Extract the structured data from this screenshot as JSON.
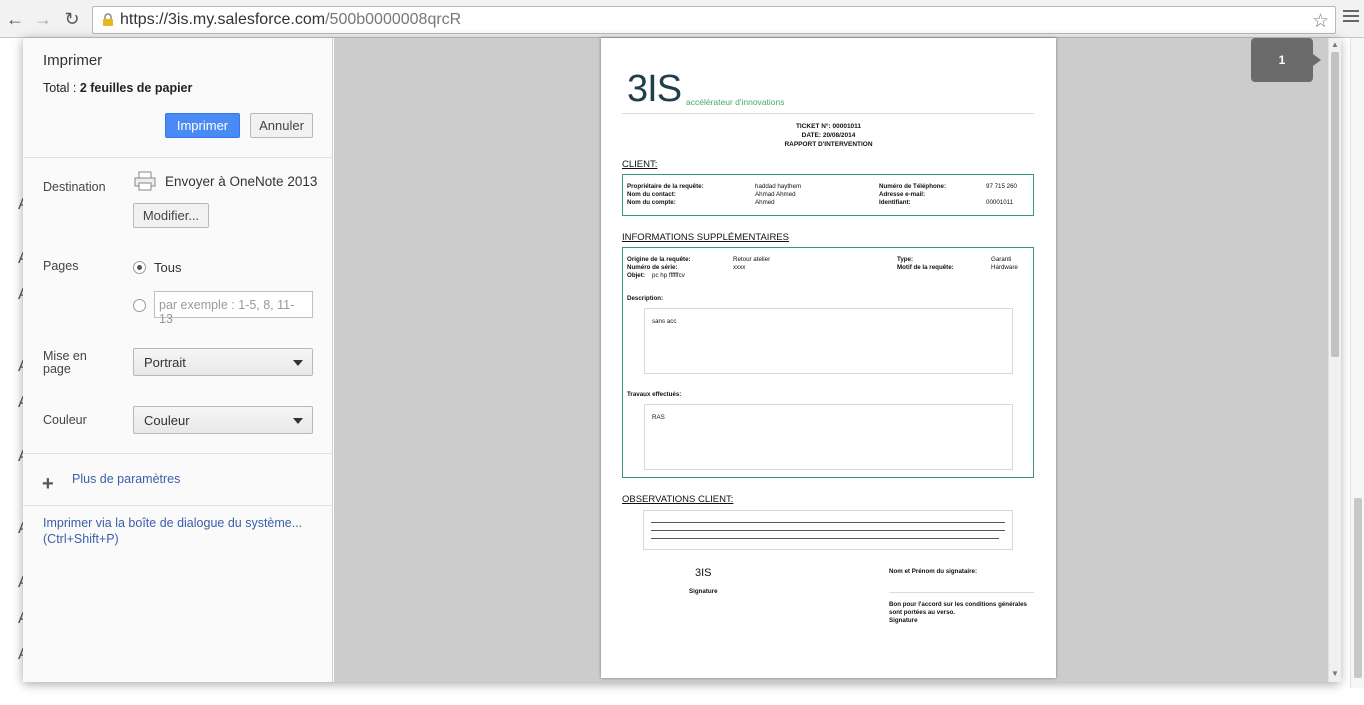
{
  "browser": {
    "url_host": "https://3is.my.salesforce.com",
    "url_path": "/500b0000008qrcR"
  },
  "background_letters": [
    "A",
    "A",
    "A",
    "A",
    "A",
    "A",
    "A",
    "A",
    "A",
    "A",
    "A"
  ],
  "print_dialog": {
    "title": "Imprimer",
    "total_label": "Total : ",
    "total_value": "2 feuilles de papier",
    "print_button": "Imprimer",
    "cancel_button": "Annuler",
    "destination_label": "Destination",
    "destination_value": "Envoyer à OneNote 2013",
    "modify_button": "Modifier...",
    "pages_label": "Pages",
    "pages_all": "Tous",
    "pages_placeholder": "par exemple : 1-5, 8, 11-13",
    "layout_label": "Mise en page",
    "layout_value": "Portrait",
    "color_label": "Couleur",
    "color_value": "Couleur",
    "more_settings": "Plus de paramètres",
    "system_dialog_line1": "Imprimer via la boîte de dialogue du système...",
    "system_dialog_line2": "(Ctrl+Shift+P)"
  },
  "preview": {
    "page_number": "1",
    "logo_text": "3IS",
    "tagline": "accélérateur d'innovations",
    "ticket": "TICKET N°: 00001011",
    "date": "DATE: 20/08/2014",
    "report_title": "RAPPORT D'INTERVENTION",
    "client_title": "CLIENT:",
    "client": {
      "owner_label": "Propriétaire de la   requête:",
      "owner_value": "haddad haythem",
      "contact_label": "Nom du contact:",
      "contact_value": "Ahmad Ahmed",
      "account_label": "Nom du compte:",
      "account_value": "Ahmed",
      "phone_label": "Numéro de Téléphone:",
      "phone_value": "97 715 260",
      "email_label": "Adresse e-mail:",
      "id_label": "Identifiant:",
      "id_value": "00001011"
    },
    "info_title": "INFORMATIONS SUPPLÉMENTAIRES",
    "info": {
      "origin_label": "Origine de la requête:",
      "origin_value": "Retour atelier",
      "serial_label": "Numéro de série:",
      "serial_value": "xxxx",
      "object_label": "Objet:",
      "object_value": "pc hp ffffffcv",
      "type_label": "Type:",
      "type_value": "Garanti",
      "reason_label": "Motif de la requête:",
      "reason_value": "Hardware",
      "description_label": "Description:",
      "description_value": "sans acc",
      "work_label": "Travaux effectués:",
      "work_value": "RAS"
    },
    "obs_title": "OBSERVATIONS CLIENT:",
    "company": "3IS",
    "signature": "Signature",
    "signatory_label": "Nom et Prénom du signataire:",
    "agreement_line1": "Bon pour l'accord sur les conditions générales",
    "agreement_line2": "sont portées au verso.",
    "agreement_signature": "Signature"
  }
}
